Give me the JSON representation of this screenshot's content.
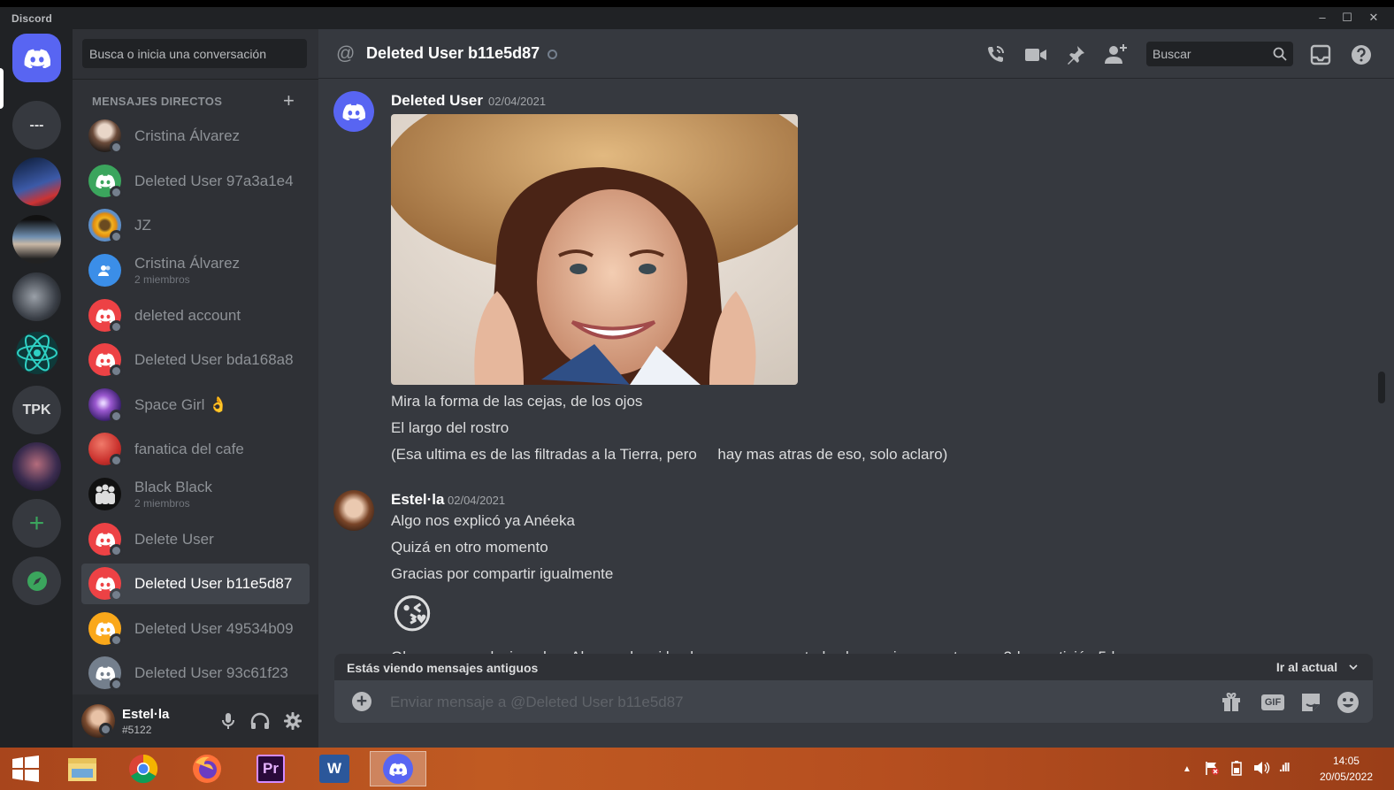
{
  "window": {
    "brand": "Discord",
    "controls": {
      "minimize": "–",
      "maximize": "☐",
      "close": "✕"
    }
  },
  "guilds": {
    "items": [
      {
        "id": "home",
        "label": ""
      },
      {
        "id": "dots",
        "label": "---"
      },
      {
        "id": "server-2",
        "label": ""
      },
      {
        "id": "server-3",
        "label": ""
      },
      {
        "id": "server-4",
        "label": ""
      },
      {
        "id": "server-5",
        "label": ""
      },
      {
        "id": "tpk",
        "label": "TPK"
      },
      {
        "id": "server-7",
        "label": ""
      },
      {
        "id": "add",
        "label": "+"
      },
      {
        "id": "explore",
        "label": ""
      }
    ]
  },
  "dm_panel": {
    "search_placeholder": "Busca o inicia una conversación",
    "header": "MENSAJES DIRECTOS",
    "add_label": "+",
    "items": [
      {
        "name": "Cristina Álvarez",
        "sub": ""
      },
      {
        "name": "Deleted User 97a3a1e4",
        "sub": ""
      },
      {
        "name": "JZ",
        "sub": ""
      },
      {
        "name": "Cristina Álvarez",
        "sub": "2 miembros"
      },
      {
        "name": "deleted account",
        "sub": ""
      },
      {
        "name": "Deleted User bda168a8",
        "sub": ""
      },
      {
        "name": "Space Girl 👌",
        "sub": ""
      },
      {
        "name": "fanatica del cafe",
        "sub": ""
      },
      {
        "name": "Black Black",
        "sub": "2 miembros"
      },
      {
        "name": "Delete User",
        "sub": ""
      },
      {
        "name": "Deleted User b11e5d87",
        "sub": ""
      },
      {
        "name": "Deleted User 49534b09",
        "sub": ""
      },
      {
        "name": "Deleted User 93c61f23",
        "sub": ""
      }
    ]
  },
  "user_panel": {
    "name": "Estel·la",
    "tag": "#5122"
  },
  "chat": {
    "header": {
      "at": "@",
      "title": "Deleted User b11e5d87",
      "search_placeholder": "Buscar"
    },
    "messages": [
      {
        "author": "Deleted User",
        "time": "02/04/2021",
        "lines": [
          "Mira la forma de las cejas, de los ojos",
          "El largo del rostro",
          "(Esa ultima es de las filtradas a la Tierra, pero     hay mas atras de eso, solo aclaro)"
        ]
      },
      {
        "author": "Estel·la",
        "time": "02/04/2021",
        "lines": [
          "Algo nos explicó ya Anéeka",
          "Quizá en otro momento",
          "Gracias por compartir igualmente"
        ],
        "emoji": "😘"
      }
    ],
    "cut_line": "Ok creo que relacionado a Alenym de mi bucle ya repasamos todas las opciones: estanque 3d, repetición 5d",
    "old_messages_bar": {
      "text": "Estás viendo mensajes antiguos",
      "jump_label": "Ir al actual"
    },
    "composer": {
      "placeholder": "Enviar mensaje a @Deleted User b11e5d87",
      "gif_label": "GIF"
    }
  },
  "taskbar": {
    "apps": [
      "start",
      "file-explorer",
      "chrome",
      "firefox",
      "premiere",
      "word",
      "discord"
    ],
    "premiere_label": "Pr",
    "word_label": "W",
    "clock": {
      "time": "14:05",
      "date": "20/05/2022"
    },
    "tray_arrow": "▲",
    "signal": ".ıll"
  },
  "colors": {
    "blurple": "#5865f2",
    "red_avatar": "#ed4245",
    "green_avatar": "#3ba55d",
    "yellow_avatar": "#faa81a",
    "grey_avatar": "#747f8d"
  }
}
